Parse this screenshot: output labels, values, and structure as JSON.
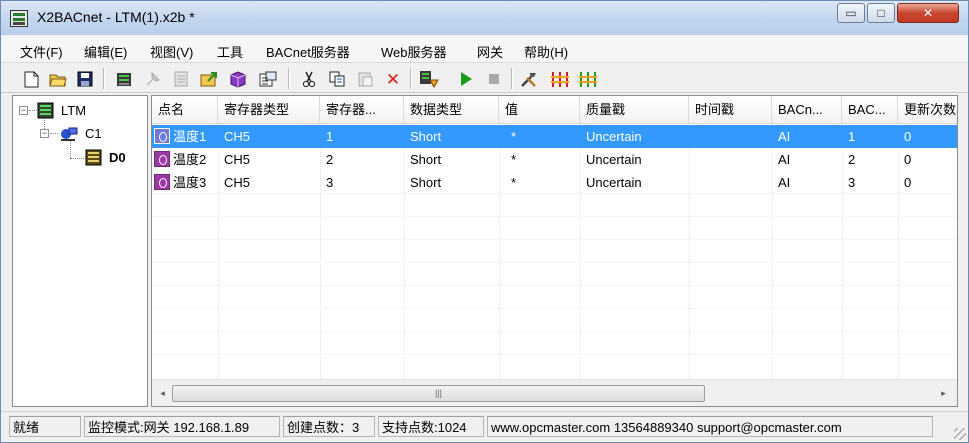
{
  "window": {
    "title": "X2BACnet - LTM(1).x2b *",
    "min_glyph": "▭",
    "max_glyph": "□",
    "close_glyph": "✕"
  },
  "menu": [
    "文件(F)",
    "编辑(E)",
    "视图(V)",
    "工具",
    "BACnet服务器",
    "Web服务器",
    "网关",
    "帮助(H)"
  ],
  "toolbar": {
    "icons": [
      "new-file-icon",
      "open-folder-icon",
      "save-icon",
      "add-device-icon",
      "disabled-pin-icon",
      "disabled-page-icon",
      "export-icon",
      "cube-icon",
      "properties-icon",
      "cut-icon",
      "copy-icon",
      "paste-icon",
      "delete-icon",
      "monitor-icon",
      "run-icon",
      "stop-icon",
      "tools-icon",
      "connect-red-icon",
      "connect-green-icon"
    ],
    "colors": {
      "run": "#1a9b1a",
      "delete": "#d81a1a",
      "disabled": "#a9a9a9"
    }
  },
  "tree": {
    "root": {
      "label": "LTM",
      "expander": "−"
    },
    "channel": {
      "label": "C1",
      "expander": "−"
    },
    "device": {
      "label": "D0"
    }
  },
  "list": {
    "columns": [
      "点名",
      "寄存器类型",
      "寄存器...",
      "数据类型",
      "值",
      "质量戳",
      "时间戳",
      "BACn...",
      "BAC...",
      "更新次数"
    ],
    "rows": [
      {
        "name": "温度1",
        "reg_type": "CH5",
        "reg": "1",
        "dtype": "Short",
        "value": "*",
        "quality": "Uncertain",
        "time": "",
        "bac_type": "AI",
        "bac_id": "1",
        "updates": "0",
        "selected": true
      },
      {
        "name": "温度2",
        "reg_type": "CH5",
        "reg": "2",
        "dtype": "Short",
        "value": "*",
        "quality": "Uncertain",
        "time": "",
        "bac_type": "AI",
        "bac_id": "2",
        "updates": "0",
        "selected": false
      },
      {
        "name": "温度3",
        "reg_type": "CH5",
        "reg": "3",
        "dtype": "Short",
        "value": "*",
        "quality": "Uncertain",
        "time": "",
        "bac_type": "AI",
        "bac_id": "3",
        "updates": "0",
        "selected": false
      }
    ],
    "selection_color": "#3399ff",
    "scroll_left_glyph": "◂",
    "scroll_right_glyph": "▸",
    "scroll_thumb_glyph": "|||"
  },
  "status": {
    "state": "就绪",
    "monitor": "监控模式:网关 192.168.1.89",
    "created": "创建点数：3",
    "supported": "支持点数:1024",
    "contact": "www.opcmaster.com 13564889340 support@opcmaster.com"
  }
}
